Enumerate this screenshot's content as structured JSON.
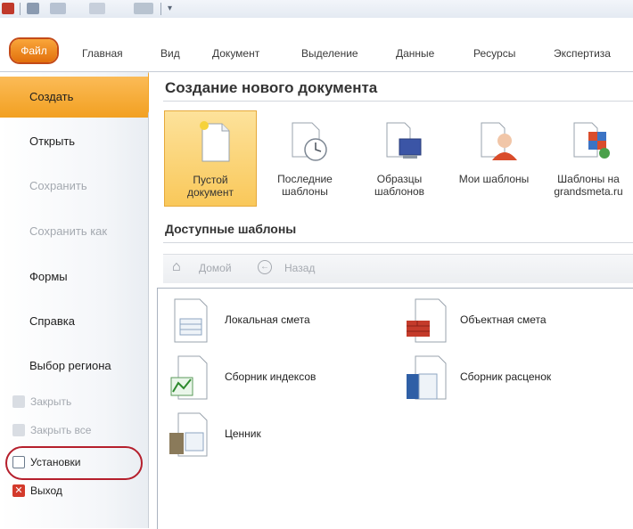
{
  "ribbon": {
    "tabs": [
      {
        "label": "Файл"
      },
      {
        "label": "Главная"
      },
      {
        "label": "Вид"
      },
      {
        "label": "Документ"
      },
      {
        "label": "Выделение"
      },
      {
        "label": "Данные"
      },
      {
        "label": "Ресурсы"
      },
      {
        "label": "Экспертиза"
      }
    ]
  },
  "nav": {
    "items": [
      {
        "label": "Создать",
        "state": "active"
      },
      {
        "label": "Открыть",
        "state": "enabled"
      },
      {
        "label": "Сохранить",
        "state": "disabled"
      },
      {
        "label": "Сохранить как",
        "state": "disabled"
      },
      {
        "label": "Формы",
        "state": "enabled"
      },
      {
        "label": "Справка",
        "state": "enabled"
      },
      {
        "label": "Выбор региона",
        "state": "enabled"
      }
    ],
    "small_items": [
      {
        "label": "Закрыть",
        "icon": "close-doc-icon",
        "state": "disabled"
      },
      {
        "label": "Закрыть все",
        "icon": "close-all-icon",
        "state": "disabled"
      },
      {
        "label": "Установки",
        "icon": "settings-doc-icon",
        "state": "enabled"
      },
      {
        "label": "Выход",
        "icon": "exit-icon",
        "state": "enabled"
      }
    ]
  },
  "main": {
    "title": "Создание нового документа",
    "tiles": [
      {
        "label": "Пустой документ",
        "icon": "blank-document-icon",
        "selected": true
      },
      {
        "label": "Последние шаблоны",
        "icon": "recent-templates-icon",
        "selected": false
      },
      {
        "label": "Образцы шаблонов",
        "icon": "sample-templates-icon",
        "selected": false
      },
      {
        "label": "Мои шаблоны",
        "icon": "my-templates-icon",
        "selected": false
      },
      {
        "label": "Шаблоны на grandsmeta.ru",
        "icon": "online-templates-icon",
        "selected": false
      }
    ],
    "available_title": "Доступные шаблоны",
    "nav_home": "Домой",
    "nav_back": "Назад",
    "templates": [
      {
        "label": "Локальная смета",
        "icon": "local-estimate-icon"
      },
      {
        "label": "Объектная смета",
        "icon": "object-estimate-icon"
      },
      {
        "label": "Сборник индексов",
        "icon": "index-collection-icon"
      },
      {
        "label": "Сборник расценок",
        "icon": "rates-collection-icon"
      },
      {
        "label": "Ценник",
        "icon": "price-list-icon"
      }
    ]
  },
  "colors": {
    "accent": "#f3a426",
    "file_tab": "#e2700c",
    "highlight_ring": "#b51f2c",
    "selected_tile": "#fbd57a"
  }
}
